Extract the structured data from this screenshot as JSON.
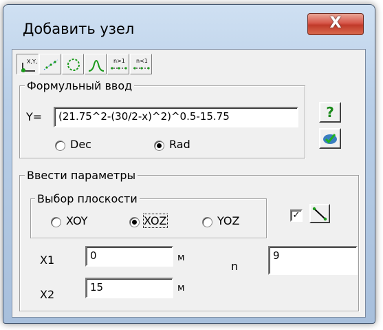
{
  "window": {
    "title": "Добавить узел",
    "close_label": "X"
  },
  "toolbar": {
    "tabs": [
      {
        "icon": "node-coords-icon",
        "label": "X,Y,Z",
        "pressed": true
      },
      {
        "icon": "line-nodes-icon",
        "pressed": false
      },
      {
        "icon": "circle-nodes-icon",
        "pressed": false
      },
      {
        "icon": "curve-nodes-icon",
        "pressed": false
      },
      {
        "icon": "n-greater-1-icon",
        "label": "n>1",
        "pressed": false
      },
      {
        "icon": "n-less-1-icon",
        "label": "n<1",
        "pressed": false
      }
    ]
  },
  "formula": {
    "group_title": "Формульный ввод",
    "y_label": "Y=",
    "y_value": "(21.75^2-(30/2-x)^2)^0.5-15.75",
    "dec_label": "Dec",
    "rad_label": "Rad",
    "selected": "Rad"
  },
  "side_buttons": {
    "help_label": "?",
    "apply_icon": "apply-check-icon"
  },
  "params": {
    "group_title": "Ввести параметры",
    "plane": {
      "group_title": "Выбор плоскости",
      "options": [
        "XOY",
        "XOZ",
        "YOZ"
      ],
      "selected": "XOZ"
    },
    "checkbox_checked": true,
    "x1_label": "X1",
    "x1_value": "0",
    "x1_unit": "м",
    "x2_label": "X2",
    "x2_value": "15",
    "x2_unit": "м",
    "n_label": "n",
    "n_value": "9"
  },
  "colors": {
    "title_bar": "#b9cfe8",
    "close_button": "#c03a2a",
    "dialog_bg": "#f0f0f0",
    "help_question": "#1a8a1a"
  }
}
